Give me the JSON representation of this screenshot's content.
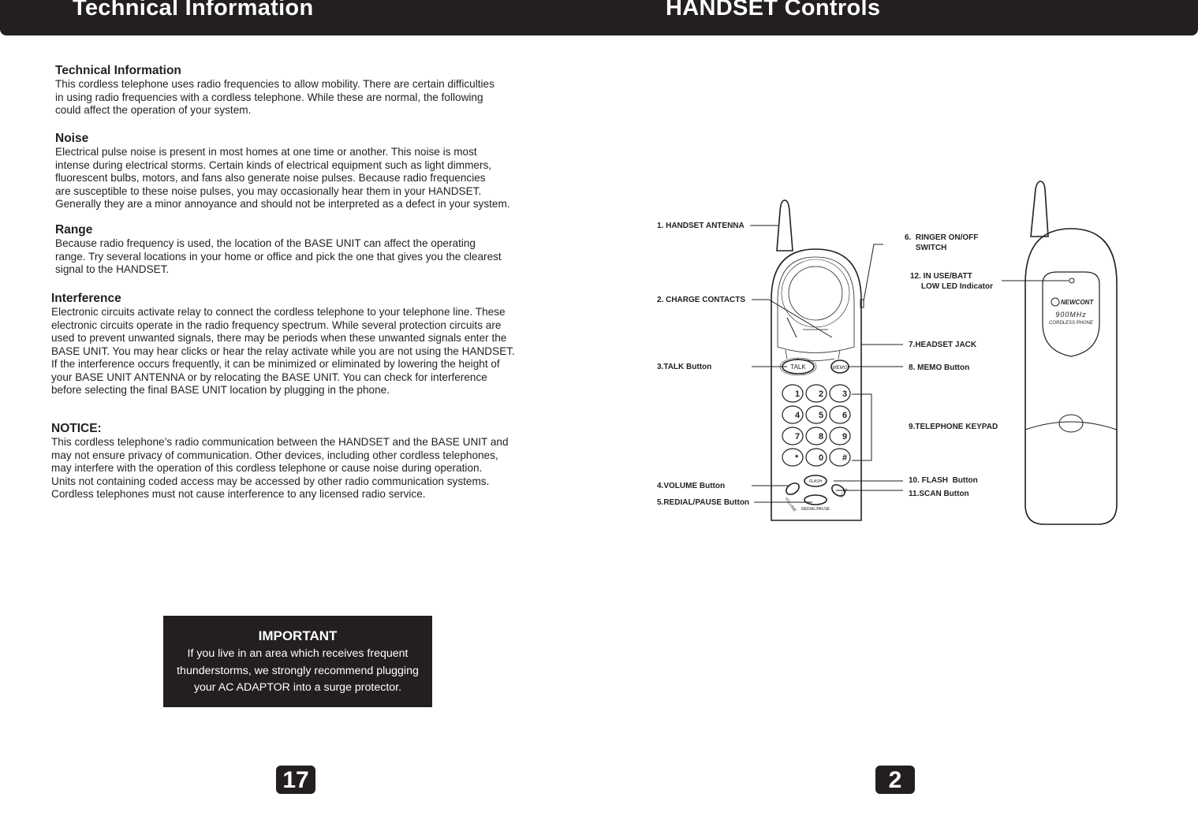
{
  "header": {
    "left_title": "Technical Information",
    "right_title": "HANDSET Controls"
  },
  "left_page": {
    "sections": [
      {
        "heading": "Technical Information",
        "body": "This cordless telephone uses radio frequencies to allow mobility. There are certain difficulties\nin using radio frequencies with a cordless telephone. While these are normal, the following\ncould affect the operation of your system."
      },
      {
        "heading": "Noise",
        "body": "Electrical pulse noise is present in most homes at one time or another. This noise is most\nintense during electrical storms. Certain kinds of electrical equipment such as light dimmers,\n fluorescent bulbs, motors, and fans also generate noise pulses. Because radio frequencies\nare susceptible to these noise pulses, you may occasionally hear them in your HANDSET.\nGenerally they are a minor annoyance and should not be interpreted as a defect in your system."
      },
      {
        "heading": "Range",
        "body": "Because radio frequency is used, the location of the BASE UNIT can affect the operating\nrange. Try several locations in your home or office and pick the one that gives you the clearest\nsignal to the HANDSET."
      },
      {
        "heading": "Interference",
        "body": "Electronic circuits activate relay to connect the cordless telephone to your telephone line. These\nelectronic circuits operate in the radio frequency spectrum. While several protection circuits are\nused to prevent unwanted signals, there may be periods when these unwanted signals enter the\nBASE UNIT. You may hear clicks or hear the relay activate while you are not using the HANDSET.\nIf the interference occurs frequently, it can be minimized or eliminated by lowering the height of\nyour BASE UNIT ANTENNA or by relocating the BASE UNIT. You can check for interference\nbefore selecting the final BASE UNIT location by plugging in the phone."
      },
      {
        "heading": "NOTICE:",
        "body": "This cordless telephone’s radio communication between the HANDSET and the BASE UNIT and\nmay not ensure privacy of communication. Other devices, including other cordless telephones,\nmay interfere with the operation of this cordless telephone or cause noise during operation.\nUnits not containing coded access may be accessed by other radio communication systems.\nCordless telephones must not cause interference to any licensed radio service."
      }
    ],
    "important": {
      "title": "IMPORTANT",
      "body": "If you live in an area which receives frequent\nthunderstorms, we strongly recommend plugging\nyour AC ADAPTOR into a surge protector."
    },
    "page_number": "17"
  },
  "right_page": {
    "labels": {
      "antenna": "1. HANDSET ANTENNA",
      "charge": "2. CHARGE CONTACTS",
      "talk": "3.TALK Button",
      "volume": "4.VOLUME Button",
      "redial": "5.REDIAL/PAUSE Button",
      "ringer": "6.  RINGER ON/OFF\n     SWITCH",
      "led": "12. IN USE/BATT\n     LOW LED Indicator",
      "headset": "7.HEADSET JACK",
      "memo": "8. MEMO Button",
      "keypad": "9.TELEPHONE KEYPAD",
      "flash": "10. FLASH  Button",
      "scan": "11.SCAN Button"
    },
    "phone_text": {
      "talk": "TALK",
      "memo": "MEMO",
      "flash": "FLASH",
      "volume": "VOLUME",
      "scan": "SCAN",
      "redial": "REDIAL/PAUSE",
      "keys": [
        "1",
        "2",
        "3",
        "4",
        "5",
        "6",
        "7",
        "8",
        "9",
        "*",
        "0",
        "#"
      ],
      "brand": "NEWCONT",
      "freq": "900MHz",
      "product": "CORDLESS PHONE"
    },
    "page_number": "2"
  }
}
